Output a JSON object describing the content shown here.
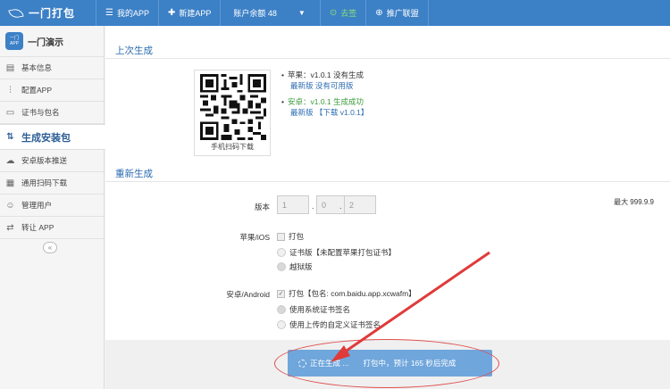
{
  "topbar": {
    "logo": "一门打包",
    "nav": [
      {
        "icon": "list-icon",
        "label": "我的APP"
      },
      {
        "icon": "plus-icon",
        "label": "新建APP"
      }
    ],
    "balance": "账户余额 48",
    "signin": "去签",
    "promo": "推广联盟"
  },
  "sidebar": {
    "app_badge_top": "一门",
    "app_badge_bottom": "APP",
    "app_name": "一门演示",
    "items": [
      {
        "icon": "info-icon",
        "label": "基本信息"
      },
      {
        "icon": "sliders-icon",
        "label": "配置APP"
      },
      {
        "icon": "certificate-icon",
        "label": "证书与包名"
      },
      {
        "icon": "build-icon",
        "label": "生成安装包"
      },
      {
        "icon": "cloud-icon",
        "label": "安卓版本推送"
      },
      {
        "icon": "qrcode-icon",
        "label": "通用扫码下载"
      },
      {
        "icon": "user-icon",
        "label": "管理用户"
      },
      {
        "icon": "transfer-icon",
        "label": "转让 APP"
      }
    ],
    "collapse": "«"
  },
  "last_build": {
    "title": "上次生成",
    "qr_caption": "手机扫码下载",
    "apple_status": "苹果：v1.0.1 没有生成",
    "apple_link": "最新版 没有可用版",
    "android_status": "安卓：v1.0.1 生成成功",
    "android_link": "最新版 【下载 v1.0.1】"
  },
  "rebuild": {
    "title": "重新生成",
    "version_label": "版本",
    "version": [
      "1",
      "0",
      "2"
    ],
    "max_note": "最大 999.9.9",
    "ios_label": "苹果/iOS",
    "ios_pack": "打包",
    "ios_opt1": "证书版【未配置苹果打包证书】",
    "ios_opt2": "越狱版",
    "android_label": "安卓/Android",
    "android_pack": "打包【包名: com.baidu.app.xcwafm】",
    "android_opt1": "使用系统证书签名",
    "android_opt2": "使用上传的自定义证书签名",
    "button_status": "正在生成 ...",
    "button_progress": "打包中，预计 165 秒后完成"
  }
}
